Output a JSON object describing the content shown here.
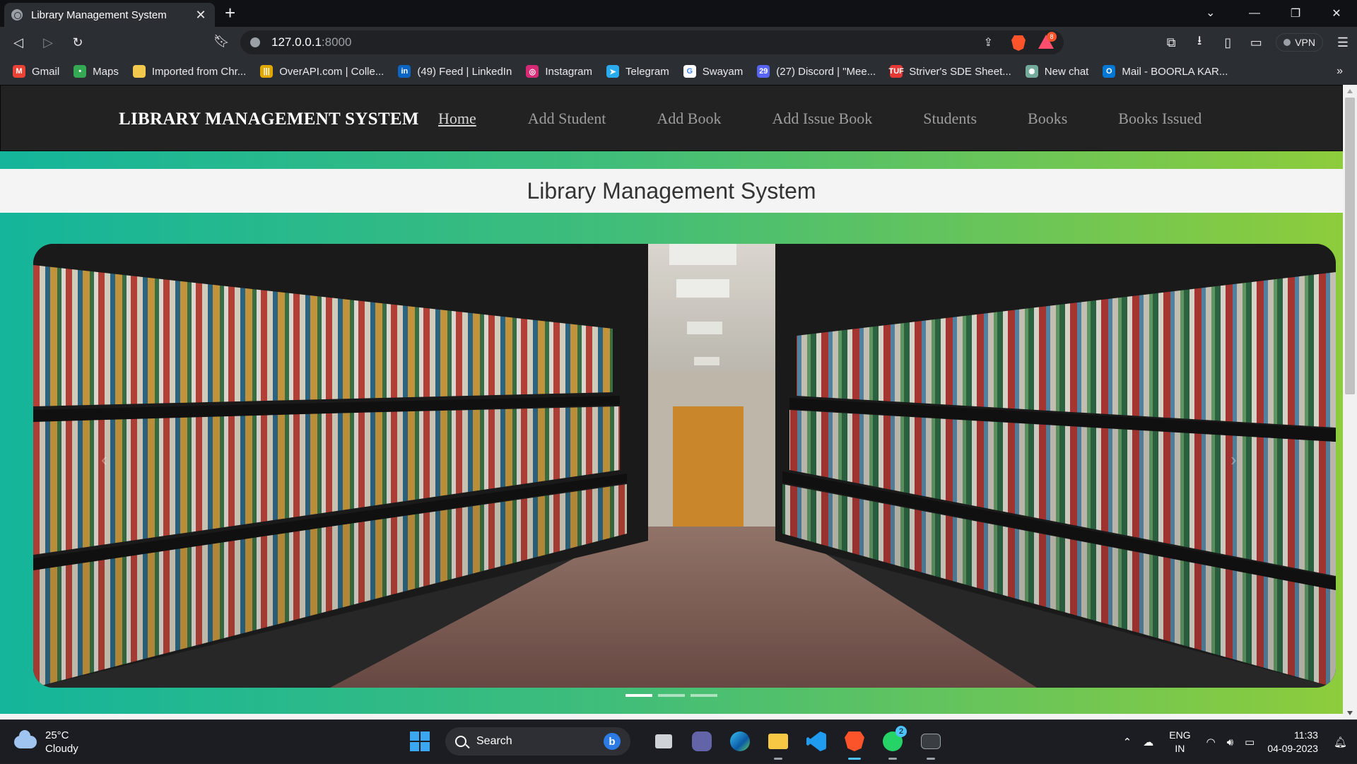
{
  "browser": {
    "tab_title": "Library Management System",
    "url_host": "127.0.0.1",
    "url_port": ":8000",
    "vpn_label": "VPN",
    "rewards_count": "8",
    "bookmarks": [
      {
        "label": "Gmail",
        "icon": "gmail-icon",
        "color": "#ea4335",
        "glyph": "M"
      },
      {
        "label": "Maps",
        "icon": "maps-icon",
        "color": "#34a853",
        "glyph": "•"
      },
      {
        "label": "Imported from Chr...",
        "icon": "folder-icon",
        "color": "#f2c94c",
        "glyph": ""
      },
      {
        "label": "OverAPI.com | Colle...",
        "icon": "overapi-icon",
        "color": "#e0a800",
        "glyph": "|||"
      },
      {
        "label": "(49) Feed | LinkedIn",
        "icon": "linkedin-icon",
        "color": "#0a66c2",
        "glyph": "in"
      },
      {
        "label": "Instagram",
        "icon": "instagram-icon",
        "color": "#d62976",
        "glyph": "◎"
      },
      {
        "label": "Telegram",
        "icon": "telegram-icon",
        "color": "#2aabee",
        "glyph": "➤"
      },
      {
        "label": "Swayam",
        "icon": "google-icon",
        "color": "#ffffff",
        "glyph": "G"
      },
      {
        "label": "(27) Discord | \"Mee...",
        "icon": "discord-icon",
        "color": "#5865f2",
        "glyph": "29"
      },
      {
        "label": "Striver's SDE Sheet...",
        "icon": "tuf-icon",
        "color": "#e53935",
        "glyph": "TUF"
      },
      {
        "label": "New chat",
        "icon": "chatgpt-icon",
        "color": "#74aa9c",
        "glyph": "✺"
      },
      {
        "label": "Mail - BOORLA KAR...",
        "icon": "outlook-icon",
        "color": "#0078d4",
        "glyph": "O"
      }
    ]
  },
  "page": {
    "brand": "LIBRARY MANAGEMENT SYSTEM",
    "nav": [
      "Home",
      "Add Student",
      "Add Book",
      "Add Issue Book",
      "Students",
      "Books",
      "Books Issued"
    ],
    "heading": "Library Management System",
    "carousel": {
      "prev_symbol": "‹",
      "next_symbol": "›",
      "slides": 3,
      "active_slide": 1
    }
  },
  "taskbar": {
    "temperature": "25°C",
    "weather": "Cloudy",
    "search_label": "Search",
    "whatsapp_badge": "2",
    "lang_top": "ENG",
    "lang_bottom": "IN",
    "time": "11:33",
    "date": "04-09-2023"
  }
}
